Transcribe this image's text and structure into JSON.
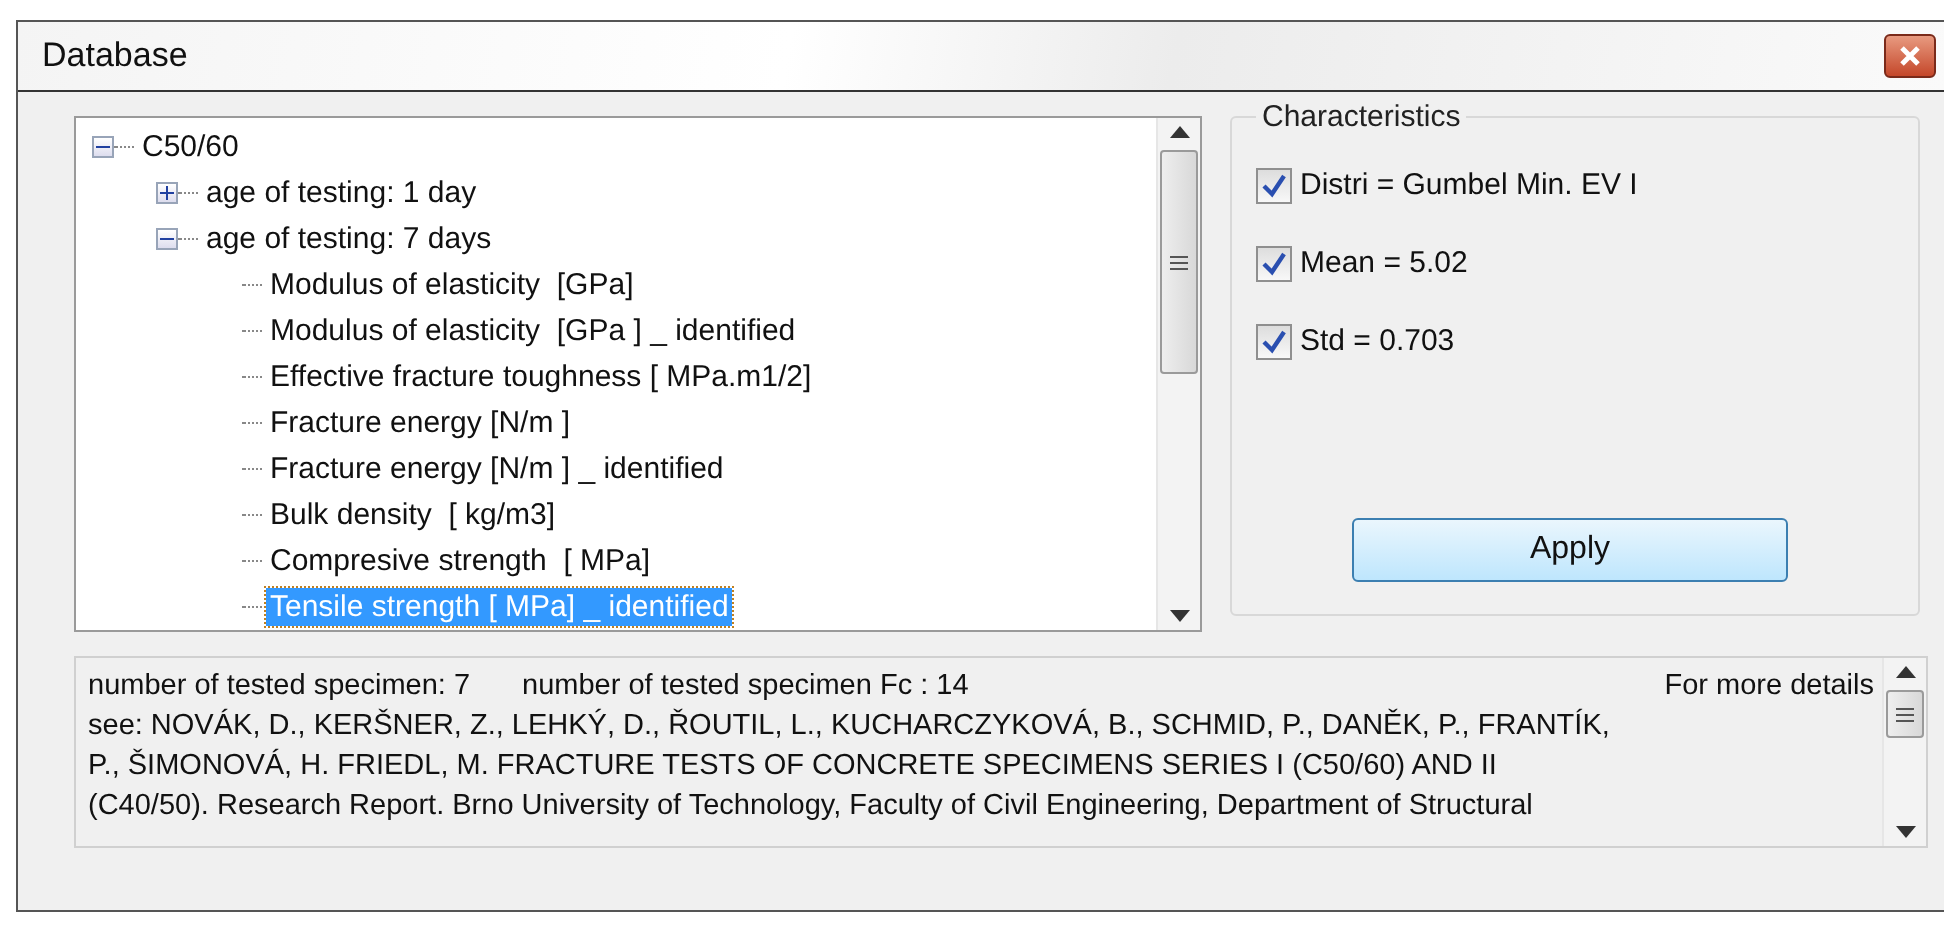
{
  "window": {
    "title": "Database"
  },
  "tree": [
    {
      "label": "C50/60",
      "expanded": true,
      "selected": false,
      "children": [
        {
          "label": "age of testing: 1 day",
          "expanded": false,
          "selected": false
        },
        {
          "label": "age of testing: 7 days",
          "expanded": true,
          "selected": false,
          "children": [
            {
              "label": "Modulus of elasticity  [GPa]",
              "selected": false
            },
            {
              "label": "Modulus of elasticity  [GPa ] _ identified",
              "selected": false
            },
            {
              "label": "Effective fracture toughness [ MPa.m1/2]",
              "selected": false
            },
            {
              "label": "Fracture energy [N/m ]",
              "selected": false
            },
            {
              "label": "Fracture energy [N/m ] _ identified",
              "selected": false
            },
            {
              "label": "Bulk density  [ kg/m3]",
              "selected": false
            },
            {
              "label": "Compresive strength  [ MPa]",
              "selected": false
            },
            {
              "label": "Tensile strength [ MPa] _ identified",
              "selected": true
            }
          ]
        }
      ]
    }
  ],
  "characteristics": {
    "title": "Characteristics",
    "items": [
      {
        "label": "Distri = Gumbel Min. EV I",
        "checked": true
      },
      {
        "label": "Mean = 5.02",
        "checked": true
      },
      {
        "label": "Std = 0.703",
        "checked": true
      }
    ],
    "button": "Apply"
  },
  "info": {
    "header": [
      "number of tested specimen: 7",
      "number of tested specimen Fc : 14",
      "For more details"
    ],
    "lines": [
      "see: NOVÁK, D., KERŠNER, Z., LEHKÝ, D., ŘOUTIL, L., KUCHARCZYKOVÁ, B., SCHMID, P., DANĚK, P., FRANTÍK,",
      "P., ŠIMONOVÁ, H. FRIEDL, M. FRACTURE TESTS OF CONCRETE SPECIMENS SERIES I (C50/60) AND II",
      "(C40/50). Research Report. Brno University of Technology, Faculty of Civil Engineering, Department of Structural"
    ]
  }
}
